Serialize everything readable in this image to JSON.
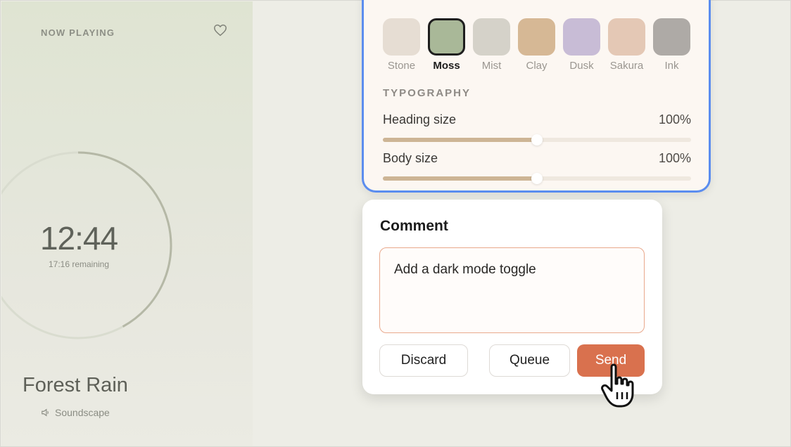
{
  "player": {
    "now_playing_label": "NOW PLAYING",
    "time": "12:44",
    "remaining": "17:16 remaining",
    "progress": 0.42,
    "track_title": "Forest Rain",
    "track_subtitle": "Soundscape",
    "icons": {
      "favorite": "heart-icon",
      "audio": "speaker-icon"
    }
  },
  "theme": {
    "swatches": [
      {
        "label": "Stone",
        "color": "#e6ddd3",
        "selected": false
      },
      {
        "label": "Moss",
        "color": "#a9b898",
        "selected": true
      },
      {
        "label": "Mist",
        "color": "#d5d2c9",
        "selected": false
      },
      {
        "label": "Clay",
        "color": "#d6b895",
        "selected": false
      },
      {
        "label": "Dusk",
        "color": "#c8bcd6",
        "selected": false
      },
      {
        "label": "Sakura",
        "color": "#e4c8b5",
        "selected": false
      },
      {
        "label": "Ink",
        "color": "#aeaaa6",
        "selected": false
      }
    ],
    "typography_title": "TYPOGRAPHY",
    "heading_size": {
      "label": "Heading size",
      "value": "100%",
      "level": 0.5
    },
    "body_size": {
      "label": "Body size",
      "value": "100%",
      "level": 0.5
    },
    "accent_border": "#5b8def"
  },
  "comment": {
    "title": "Comment",
    "input_value": "Add a dark mode toggle",
    "buttons": {
      "discard": "Discard",
      "queue": "Queue",
      "send": "Send"
    },
    "send_color": "#d9714e"
  }
}
